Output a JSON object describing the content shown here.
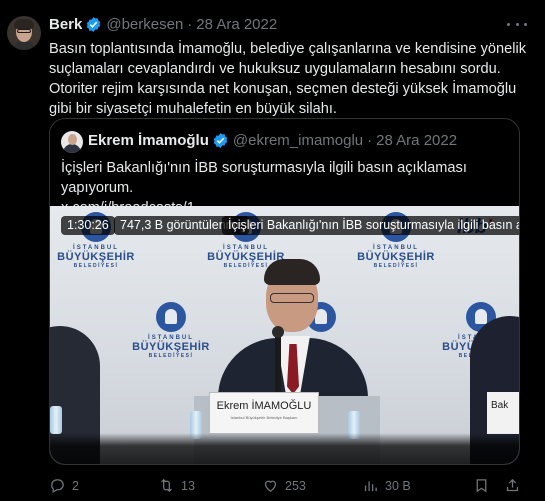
{
  "tweet": {
    "name": "Berk",
    "handle": "@berkesen",
    "separator": "·",
    "date": "28 Ara 2022",
    "text": "Basın toplantısında İmamoğlu, belediye çalışanlarına ve kendisine yönelik suçlamaları cevaplandırdı ve hukuksuz uygulamaların hesabını sordu. Otoriter rejim karşısında net konuşan, seçmen desteği yüksek İmamoğlu gibi bir siyasetçi muhalefetin en büyük silahı."
  },
  "quoted": {
    "name": "Ekrem İmamoğlu",
    "handle": "@ekrem_imamoglu",
    "separator": "·",
    "date": "28 Ara 2022",
    "text_line1": "İçişleri Bakanlığı'nın İBB soruşturmasıyla ilgili basın açıklaması yapıyorum.",
    "text_line2": "x.com/i/broadcasts/1..."
  },
  "video": {
    "logo_line1": "İSTANBUL",
    "logo_line2": "BÜYÜKŞEHİR",
    "logo_line3": "BELEDİYESİ",
    "brand": "ibb",
    "nameplate_name": "Ekrem İMAMOĞLU",
    "nameplate_title": "İstanbul Büyükşehir Belediye Başkanı",
    "right_plate": "Bak",
    "duration": "1:30:26",
    "views": "747,3 B görüntülenme",
    "caption": "İçişleri Bakanlığı'nın İBB soruşturmasıyla ilgili basın a"
  },
  "actions": {
    "reply_count": "2",
    "retweet_count": "13",
    "like_count": "253",
    "view_count": "30 B"
  },
  "colors": {
    "background": "#000000",
    "text": "#e7e9ea",
    "muted": "#71767b",
    "verified": "#1d9bf0",
    "border": "#2f3336"
  },
  "icons": [
    "verified-badge-icon",
    "more-icon",
    "reply-icon",
    "retweet-icon",
    "like-icon",
    "views-icon",
    "bookmark-icon",
    "share-icon"
  ]
}
